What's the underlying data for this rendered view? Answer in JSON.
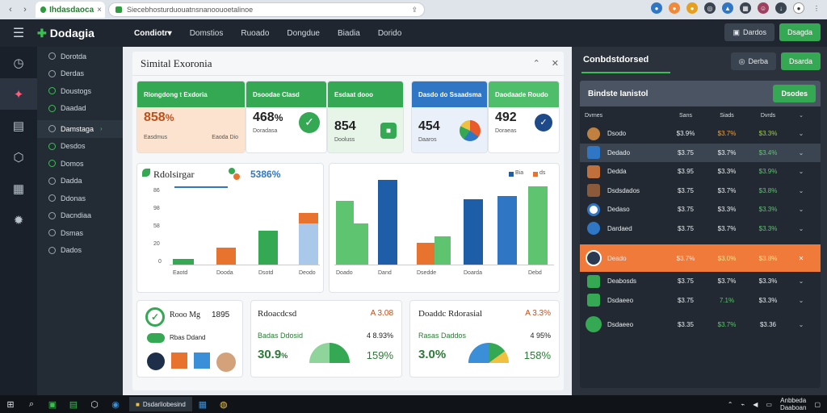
{
  "browser": {
    "tab_title": "Ihdasdaoca",
    "tab_close": "×",
    "url": "Siecebhosturduouatnsnanoouoetalinoe",
    "back": "‹",
    "forward": "›",
    "reload": "C"
  },
  "topbar": {
    "brand": "Dodagia",
    "nav": [
      "Condiotr▾",
      "Domstios",
      "Ruoado",
      "Dongdue",
      "Biadia",
      "Dorido"
    ],
    "btn_secondary": "Dardos",
    "btn_primary": "Dsagda"
  },
  "sidebar": {
    "items": [
      {
        "label": "Dorotda"
      },
      {
        "label": "Derdas"
      },
      {
        "label": "Doustogs"
      },
      {
        "label": "Daadad"
      },
      {
        "label": "Damstaga"
      },
      {
        "label": "Desdos"
      },
      {
        "label": "Domos"
      },
      {
        "label": "Dadda"
      },
      {
        "label": "Ddonas"
      },
      {
        "label": "Dacndiaa"
      },
      {
        "label": "Dsmas"
      },
      {
        "label": "Dados"
      }
    ]
  },
  "panel": {
    "title": "Simital Exoronia",
    "kpis": [
      {
        "header": "Riongdong t Exdoria",
        "value": "858",
        "unit": "%",
        "sub_left": "Easdmus",
        "sub_right": "Eaoda Dio",
        "color": "#34a853"
      },
      {
        "header": "Dsoodae Clasd",
        "value": "468",
        "unit": "%",
        "sub_left": "Doradasa",
        "color": "#34a853"
      },
      {
        "header": "Esdaat dooo",
        "value": "854",
        "unit": "",
        "sub_left": "Dooluss",
        "color": "#34a853"
      },
      {
        "header": "Dasdo do Ssaadsma",
        "value": "454",
        "unit": "",
        "sub_left": "Daaros",
        "color": "#2f77c4"
      },
      {
        "header": "Daodaade Roudo",
        "value": "492",
        "unit": "",
        "sub_left": "Doraeas",
        "color": "#4fbe6a"
      }
    ],
    "chart1": {
      "title": "Rdolsirgar",
      "value": "5386",
      "unit": "%",
      "yticks": [
        "86",
        "98",
        "58",
        "20",
        "0"
      ],
      "categories": [
        "Eaotd",
        "Dooda",
        "Dsotd",
        "Deodo"
      ]
    },
    "chart2": {
      "legend": [
        "Bia",
        "ds"
      ],
      "categories": [
        "Doado",
        "Dand",
        "Dsedde",
        "Doarda",
        "Debd"
      ]
    },
    "bottom": [
      {
        "title": "Rooo Mg",
        "value": "1895",
        "sub": "Rbas Ddand"
      },
      {
        "title": "Rdoacdcsd",
        "value": "A 3.08",
        "sub_label": "Badas Ddosid",
        "sub_value": "4 8.93%",
        "big": "30.9",
        "big_unit": "%",
        "pct": "159%"
      },
      {
        "title": "Doaddc Rdorasial",
        "value": "A 3.3%",
        "sub_label": "Rasas Daddos",
        "sub_value": "4 95%",
        "big": "3.0%",
        "big_unit": "%",
        "pct": "158%"
      }
    ]
  },
  "right": {
    "title": "Conbdstdorsed",
    "btn_secondary": "Derba",
    "btn_primary": "Dsarda",
    "table_title": "Bindste Ianistol",
    "table_btn": "Dsodes",
    "cols": [
      "Dvrnes",
      "Sans",
      "Siads",
      "Dvrds",
      "Dsads"
    ],
    "rows": [
      {
        "name": "Dsodo",
        "a": "$3.9%",
        "b": "$3.7%",
        "c": "$3.3%",
        "color": "#f0c040"
      },
      {
        "name": "Dedado",
        "a": "$3.75",
        "b": "$3.7%",
        "c": "$3.4%",
        "color": "#2f77c4"
      },
      {
        "name": "Dedda",
        "a": "$3.95",
        "b": "$3.3%",
        "c": "$3.9%",
        "color": "#c0703a"
      },
      {
        "name": "Dsdsdados",
        "a": "$3.75",
        "b": "$3.7%",
        "c": "$3.8%",
        "color": "#8a5a3a"
      },
      {
        "name": "Dedaso",
        "a": "$3.75",
        "b": "$3.3%",
        "c": "$3.3%",
        "color": "#2f77c4"
      },
      {
        "name": "Dardaed",
        "a": "$3.75",
        "b": "$3.7%",
        "c": "$3.3%",
        "color": "#2f77c4"
      },
      {
        "name": "Deado",
        "a": "$3.7%",
        "b": "$3.0%",
        "c": "$3.8%",
        "color": "#e58a2a"
      },
      {
        "name": "Deabosds",
        "a": "$3.75",
        "b": "$3.7%",
        "c": "$3.3%",
        "color": "#34a853"
      },
      {
        "name": "Dsdaeeo",
        "a": "$3.75",
        "b": "7.1%",
        "c": "$3.3%",
        "color": "#34a853"
      },
      {
        "name": "Dsdaeeo",
        "a": "$3.35",
        "b": "$3.7%",
        "c": "$3.36",
        "color": "#34a853"
      }
    ]
  },
  "taskbar": {
    "app": "Dsdarliobesind",
    "time": "Anbbeda",
    "date": "Daaboan"
  }
}
